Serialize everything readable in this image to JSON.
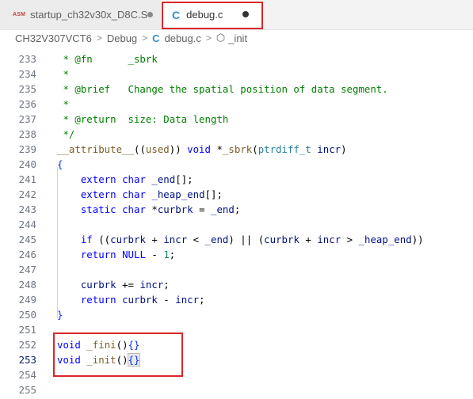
{
  "tabs": [
    {
      "icon": "asm-icon",
      "icon_text": "ASM",
      "label": "startup_ch32v30x_D8C.S",
      "modified": true
    },
    {
      "icon": "c-file-icon",
      "icon_text": "C",
      "label": "debug.c",
      "modified": true,
      "active": true
    }
  ],
  "breadcrumb": {
    "items": [
      "CH32V307VCT6",
      "Debug",
      "debug.c",
      "_init"
    ],
    "separator": ">",
    "file_icon": "C"
  },
  "colors": {
    "highlight_border": "#d9262b",
    "comment": "#008000",
    "keyword": "#0000ff"
  },
  "editor": {
    "current_line": 253,
    "lines": [
      {
        "num": "233",
        "tokens": [
          {
            "t": " * @fn      _sbrk",
            "c": "cm"
          }
        ]
      },
      {
        "num": "234",
        "tokens": [
          {
            "t": " *",
            "c": "cm"
          }
        ]
      },
      {
        "num": "235",
        "tokens": [
          {
            "t": " * @brief   Change the spatial position of data segment.",
            "c": "cm"
          }
        ]
      },
      {
        "num": "236",
        "tokens": [
          {
            "t": " *",
            "c": "cm"
          }
        ]
      },
      {
        "num": "237",
        "tokens": [
          {
            "t": " * @return  size: Data length",
            "c": "cm"
          }
        ]
      },
      {
        "num": "238",
        "tokens": [
          {
            "t": " */",
            "c": "cm"
          }
        ]
      },
      {
        "num": "239",
        "tokens": [
          {
            "t": "__attribute__",
            "c": "fn"
          },
          {
            "t": "((",
            "c": ""
          },
          {
            "t": "used",
            "c": "fn"
          },
          {
            "t": ")) ",
            "c": ""
          },
          {
            "t": "void",
            "c": "kw"
          },
          {
            "t": " *",
            "c": ""
          },
          {
            "t": "_sbrk",
            "c": "fn"
          },
          {
            "t": "(",
            "c": ""
          },
          {
            "t": "ptrdiff_t",
            "c": "ty"
          },
          {
            "t": " ",
            "c": ""
          },
          {
            "t": "incr",
            "c": "pm"
          },
          {
            "t": ")",
            "c": ""
          }
        ]
      },
      {
        "num": "240",
        "tokens": [
          {
            "t": "{",
            "c": "br"
          }
        ]
      },
      {
        "num": "241",
        "tokens": [
          {
            "t": "    ",
            "c": ""
          },
          {
            "t": "extern",
            "c": "kw"
          },
          {
            "t": " ",
            "c": ""
          },
          {
            "t": "char",
            "c": "kw"
          },
          {
            "t": " ",
            "c": ""
          },
          {
            "t": "_end",
            "c": "pm"
          },
          {
            "t": "[];",
            "c": ""
          }
        ]
      },
      {
        "num": "242",
        "tokens": [
          {
            "t": "    ",
            "c": ""
          },
          {
            "t": "extern",
            "c": "kw"
          },
          {
            "t": " ",
            "c": ""
          },
          {
            "t": "char",
            "c": "kw"
          },
          {
            "t": " ",
            "c": ""
          },
          {
            "t": "_heap_end",
            "c": "pm"
          },
          {
            "t": "[];",
            "c": ""
          }
        ]
      },
      {
        "num": "243",
        "tokens": [
          {
            "t": "    ",
            "c": ""
          },
          {
            "t": "static",
            "c": "kw"
          },
          {
            "t": " ",
            "c": ""
          },
          {
            "t": "char",
            "c": "kw"
          },
          {
            "t": " *",
            "c": ""
          },
          {
            "t": "curbrk",
            "c": "pm"
          },
          {
            "t": " = ",
            "c": ""
          },
          {
            "t": "_end",
            "c": "pm"
          },
          {
            "t": ";",
            "c": ""
          }
        ]
      },
      {
        "num": "244",
        "tokens": []
      },
      {
        "num": "245",
        "tokens": [
          {
            "t": "    ",
            "c": ""
          },
          {
            "t": "if",
            "c": "kw"
          },
          {
            "t": " ((",
            "c": ""
          },
          {
            "t": "curbrk",
            "c": "pm"
          },
          {
            "t": " + ",
            "c": ""
          },
          {
            "t": "incr",
            "c": "pm"
          },
          {
            "t": " < ",
            "c": ""
          },
          {
            "t": "_end",
            "c": "pm"
          },
          {
            "t": ") || (",
            "c": ""
          },
          {
            "t": "curbrk",
            "c": "pm"
          },
          {
            "t": " + ",
            "c": ""
          },
          {
            "t": "incr",
            "c": "pm"
          },
          {
            "t": " > ",
            "c": ""
          },
          {
            "t": "_heap_end",
            "c": "pm"
          },
          {
            "t": "))",
            "c": ""
          }
        ]
      },
      {
        "num": "246",
        "tokens": [
          {
            "t": "    ",
            "c": ""
          },
          {
            "t": "return",
            "c": "kw"
          },
          {
            "t": " ",
            "c": ""
          },
          {
            "t": "NULL",
            "c": "kw"
          },
          {
            "t": " - ",
            "c": ""
          },
          {
            "t": "1",
            "c": "num"
          },
          {
            "t": ";",
            "c": ""
          }
        ]
      },
      {
        "num": "247",
        "tokens": []
      },
      {
        "num": "248",
        "tokens": [
          {
            "t": "    ",
            "c": ""
          },
          {
            "t": "curbrk",
            "c": "pm"
          },
          {
            "t": " += ",
            "c": ""
          },
          {
            "t": "incr",
            "c": "pm"
          },
          {
            "t": ";",
            "c": ""
          }
        ]
      },
      {
        "num": "249",
        "tokens": [
          {
            "t": "    ",
            "c": ""
          },
          {
            "t": "return",
            "c": "kw"
          },
          {
            "t": " ",
            "c": ""
          },
          {
            "t": "curbrk",
            "c": "pm"
          },
          {
            "t": " - ",
            "c": ""
          },
          {
            "t": "incr",
            "c": "pm"
          },
          {
            "t": ";",
            "c": ""
          }
        ]
      },
      {
        "num": "250",
        "tokens": [
          {
            "t": "}",
            "c": "br"
          }
        ]
      },
      {
        "num": "251",
        "tokens": []
      },
      {
        "num": "252",
        "tokens": [
          {
            "t": "void",
            "c": "kw"
          },
          {
            "t": " ",
            "c": ""
          },
          {
            "t": "_fini",
            "c": "fn"
          },
          {
            "t": "()",
            "c": ""
          },
          {
            "t": "{}",
            "c": "br"
          }
        ]
      },
      {
        "num": "253",
        "tokens": [
          {
            "t": "void",
            "c": "kw"
          },
          {
            "t": " ",
            "c": ""
          },
          {
            "t": "_init",
            "c": "fn"
          },
          {
            "t": "()",
            "c": ""
          },
          {
            "t": "{}",
            "c": "br",
            "match": true
          }
        ]
      },
      {
        "num": "254",
        "tokens": []
      },
      {
        "num": "255",
        "tokens": []
      }
    ]
  }
}
